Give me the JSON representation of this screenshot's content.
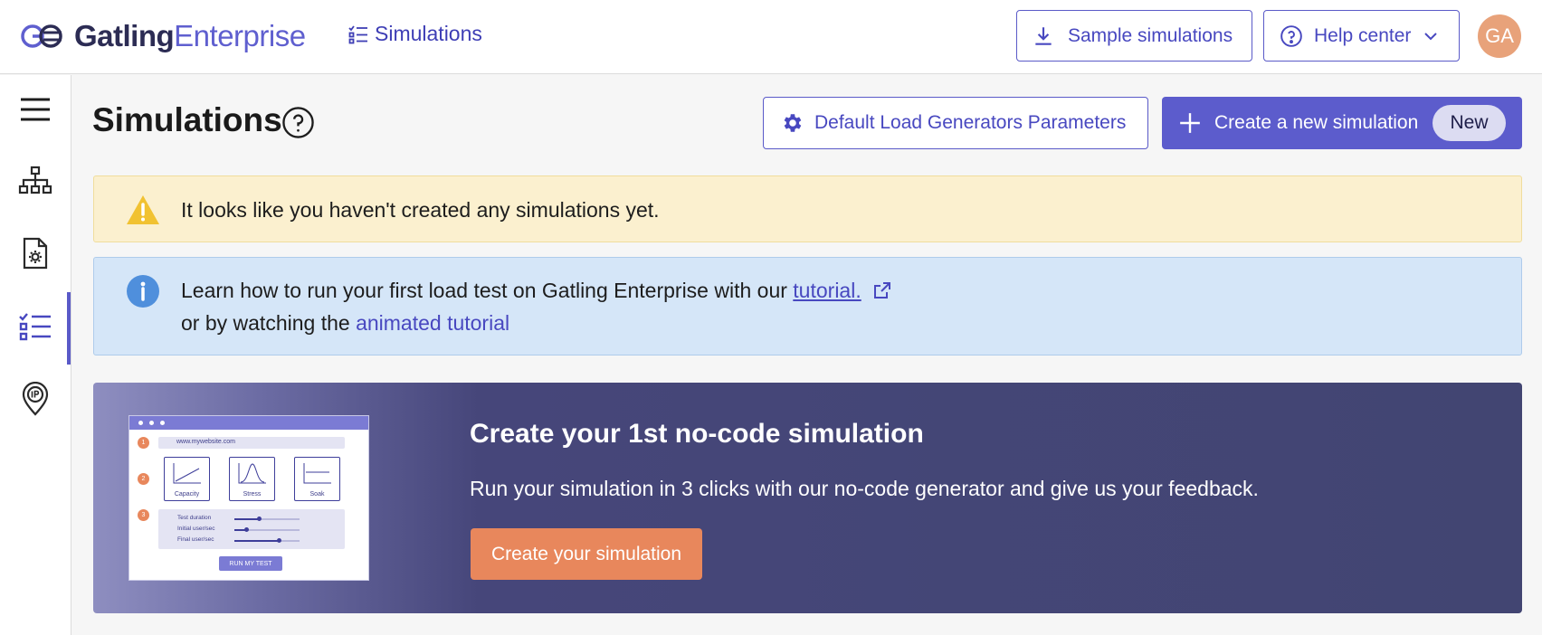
{
  "brand": {
    "bold": "Gatling",
    "light": "Enterprise"
  },
  "top_nav": {
    "label": "Simulations"
  },
  "header_actions": {
    "sample_label": "Sample simulations",
    "help_label": "Help center",
    "avatar_initials": "GA"
  },
  "page": {
    "title": "Simulations",
    "default_params_label": "Default Load Generators Parameters",
    "create_label": "Create a new simulation",
    "new_badge": "New"
  },
  "warning": {
    "text": "It looks like you haven't created any simulations yet."
  },
  "info": {
    "line1_prefix": "Learn how to run your first load test on Gatling Enterprise with our",
    "tutorial_link": "tutorial.",
    "line2_prefix": "or by watching the",
    "animated_link": "animated tutorial"
  },
  "promo": {
    "title": "Create your 1st no-code simulation",
    "subtitle": "Run your simulation in 3 clicks with our no-code generator and give us your feedback.",
    "button": "Create your simulation",
    "illustration": {
      "url": "www.mywebsite.com",
      "steps": [
        "1",
        "2",
        "3"
      ],
      "tests": [
        "Capacity",
        "Stress",
        "Soak"
      ],
      "params": [
        {
          "label": "Test duration",
          "level": 0.38
        },
        {
          "label": "Initial user/sec",
          "level": 0.18
        },
        {
          "label": "Final user/sec",
          "level": 0.68
        }
      ],
      "run_button": "RUN MY TEST"
    }
  },
  "sidebar": {
    "items": [
      {
        "icon": "menu-icon"
      },
      {
        "icon": "sitemap-icon"
      },
      {
        "icon": "file-gear-icon"
      },
      {
        "icon": "checklist-icon",
        "active": true
      },
      {
        "icon": "ip-pin-icon"
      }
    ]
  },
  "colors": {
    "accent": "#5c5ccc",
    "warning_bg": "#fbf0cf",
    "info_bg": "#d5e6f8",
    "promo_bg": "#424572",
    "promo_button": "#e8875c",
    "avatar_bg": "#e8a27a"
  }
}
